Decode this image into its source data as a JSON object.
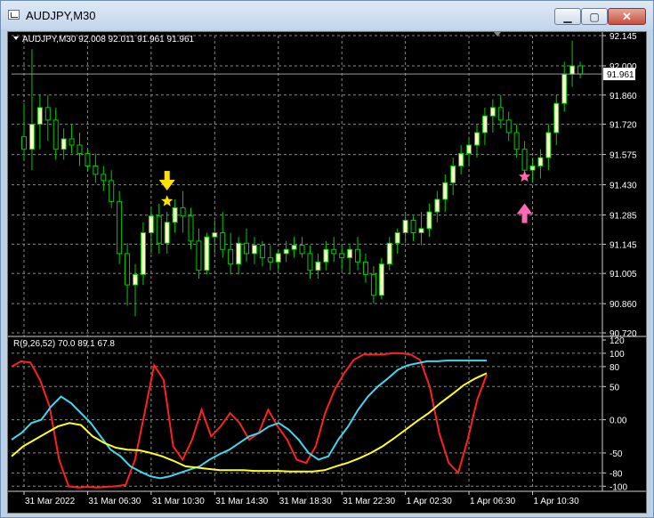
{
  "window": {
    "title": "AUDJPY,M30",
    "min_glyph": "▁",
    "max_glyph": "▢",
    "close_glyph": "✕"
  },
  "price_panel": {
    "header": "AUDJPY,M30  92.008 92.011 91.961 91.961",
    "current_price": "91.961",
    "y_ticks": [
      "92.145",
      "92.000",
      "91.860",
      "91.720",
      "91.575",
      "91.430",
      "91.285",
      "91.145",
      "91.005",
      "90.860",
      "90.720"
    ]
  },
  "indicator_panel": {
    "header": "R(9,26,52) 70.0 89.1 67.8",
    "y_ticks": [
      "120",
      "100",
      "80",
      "50",
      "0.00",
      "-50",
      "-80",
      "-100"
    ]
  },
  "time_axis": [
    "31 Mar 2022",
    "31 Mar 06:30",
    "31 Mar 10:30",
    "31 Mar 14:30",
    "31 Mar 18:30",
    "31 Mar 22:30",
    "1 Apr 02:30",
    "1 Apr 06:30",
    "1 Apr 10:30"
  ],
  "colors": {
    "bg": "#000000",
    "grid": "#8a8a8a",
    "candle_up": "#00cc00",
    "candle_bull_fill": "#ffffcc",
    "line_red": "#ff2020",
    "line_cyan": "#40d8f0",
    "line_yellow": "#ffff20",
    "arrow_down": "#ffe000",
    "arrow_up": "#ff69b4"
  },
  "chart_data": {
    "type": "candlestick",
    "symbol": "AUDJPY",
    "timeframe": "M30",
    "ylim": [
      90.72,
      92.145
    ],
    "candles": [
      [
        91.66,
        91.82,
        91.55,
        91.6
      ],
      [
        91.6,
        92.08,
        91.5,
        91.72
      ],
      [
        91.72,
        91.86,
        91.6,
        91.8
      ],
      [
        91.8,
        91.86,
        91.64,
        91.74
      ],
      [
        91.74,
        91.8,
        91.55,
        91.6
      ],
      [
        91.6,
        91.7,
        91.55,
        91.65
      ],
      [
        91.65,
        91.72,
        91.58,
        91.62
      ],
      [
        91.62,
        91.68,
        91.52,
        91.58
      ],
      [
        91.58,
        91.6,
        91.5,
        91.52
      ],
      [
        91.52,
        91.58,
        91.44,
        91.48
      ],
      [
        91.48,
        91.52,
        91.4,
        91.45
      ],
      [
        91.45,
        91.5,
        91.32,
        91.35
      ],
      [
        91.35,
        91.4,
        91.05,
        91.1
      ],
      [
        91.1,
        91.15,
        90.85,
        90.95
      ],
      [
        90.95,
        91.05,
        90.8,
        91.0
      ],
      [
        91.0,
        91.25,
        90.95,
        91.2
      ],
      [
        91.2,
        91.32,
        91.1,
        91.28
      ],
      [
        91.28,
        91.34,
        91.1,
        91.15
      ],
      [
        91.15,
        91.3,
        91.1,
        91.25
      ],
      [
        91.25,
        91.36,
        91.2,
        91.32
      ],
      [
        91.32,
        91.4,
        91.2,
        91.28
      ],
      [
        91.28,
        91.32,
        91.12,
        91.16
      ],
      [
        91.16,
        91.22,
        90.98,
        91.02
      ],
      [
        91.02,
        91.2,
        91.0,
        91.18
      ],
      [
        91.18,
        91.26,
        91.1,
        91.2
      ],
      [
        91.2,
        91.3,
        91.08,
        91.12
      ],
      [
        91.12,
        91.2,
        91.0,
        91.05
      ],
      [
        91.05,
        91.18,
        91.0,
        91.15
      ],
      [
        91.15,
        91.22,
        91.06,
        91.1
      ],
      [
        91.1,
        91.18,
        91.05,
        91.14
      ],
      [
        91.14,
        91.16,
        91.04,
        91.08
      ],
      [
        91.08,
        91.14,
        91.02,
        91.06
      ],
      [
        91.06,
        91.12,
        91.02,
        91.1
      ],
      [
        91.1,
        91.16,
        91.06,
        91.12
      ],
      [
        91.12,
        91.18,
        91.08,
        91.14
      ],
      [
        91.14,
        91.18,
        91.08,
        91.1
      ],
      [
        91.1,
        91.14,
        90.98,
        91.02
      ],
      [
        91.02,
        91.1,
        90.98,
        91.06
      ],
      [
        91.06,
        91.16,
        91.02,
        91.12
      ],
      [
        91.12,
        91.18,
        91.06,
        91.1
      ],
      [
        91.1,
        91.14,
        91.02,
        91.08
      ],
      [
        91.08,
        91.14,
        91.0,
        91.12
      ],
      [
        91.12,
        91.18,
        91.02,
        91.06
      ],
      [
        91.06,
        91.1,
        90.96,
        91.0
      ],
      [
        91.0,
        91.04,
        90.86,
        90.9
      ],
      [
        90.9,
        91.08,
        90.88,
        91.05
      ],
      [
        91.05,
        91.18,
        91.02,
        91.15
      ],
      [
        91.15,
        91.22,
        91.1,
        91.2
      ],
      [
        91.2,
        91.3,
        91.15,
        91.26
      ],
      [
        91.26,
        91.28,
        91.16,
        91.2
      ],
      [
        91.2,
        91.3,
        91.14,
        91.22
      ],
      [
        91.22,
        91.34,
        91.18,
        91.3
      ],
      [
        91.3,
        91.4,
        91.25,
        91.36
      ],
      [
        91.36,
        91.48,
        91.3,
        91.44
      ],
      [
        91.44,
        91.56,
        91.38,
        91.52
      ],
      [
        91.52,
        91.62,
        91.48,
        91.58
      ],
      [
        91.58,
        91.66,
        91.52,
        91.62
      ],
      [
        91.62,
        91.72,
        91.56,
        91.68
      ],
      [
        91.68,
        91.8,
        91.62,
        91.76
      ],
      [
        91.76,
        91.84,
        91.68,
        91.8
      ],
      [
        91.8,
        91.86,
        91.7,
        91.74
      ],
      [
        91.74,
        91.78,
        91.64,
        91.68
      ],
      [
        91.68,
        91.72,
        91.56,
        91.6
      ],
      [
        91.6,
        91.64,
        91.46,
        91.5
      ],
      [
        91.5,
        91.56,
        91.44,
        91.52
      ],
      [
        91.52,
        91.6,
        91.46,
        91.56
      ],
      [
        91.56,
        91.72,
        91.5,
        91.68
      ],
      [
        91.68,
        91.86,
        91.62,
        91.82
      ],
      [
        91.82,
        92.02,
        91.78,
        91.96
      ],
      [
        91.96,
        92.12,
        91.9,
        92.0
      ],
      [
        92.0,
        92.02,
        91.94,
        91.961
      ]
    ],
    "markers": [
      {
        "type": "arrow-down",
        "candle": 18,
        "color": "#ffe000"
      },
      {
        "type": "star",
        "candle": 18,
        "color": "#ffe000"
      },
      {
        "type": "arrow-up",
        "candle": 63,
        "color": "#ff69b4"
      },
      {
        "type": "star",
        "candle": 63,
        "color": "#ff69b4"
      }
    ],
    "indicator": {
      "name": "R(9,26,52)",
      "ylim": [
        -105,
        120
      ],
      "series": [
        {
          "color": "#ff2020",
          "values": [
            80,
            88,
            86,
            60,
            20,
            -60,
            -100,
            -102,
            -101,
            -102,
            -101,
            -100,
            -98,
            -60,
            10,
            82,
            60,
            -40,
            -60,
            -30,
            15,
            -25,
            -10,
            10,
            -5,
            -30,
            -20,
            15,
            -10,
            -30,
            -60,
            -65,
            -40,
            10,
            45,
            70,
            90,
            98,
            98,
            98,
            100,
            100,
            98,
            90,
            50,
            -20,
            -65,
            -80,
            -30,
            30,
            67.8
          ]
        },
        {
          "color": "#40d8f0",
          "values": [
            -30,
            -20,
            -5,
            0,
            20,
            35,
            25,
            10,
            -5,
            -25,
            -45,
            -55,
            -70,
            -78,
            -85,
            -88,
            -85,
            -80,
            -75,
            -70,
            -60,
            -52,
            -45,
            -35,
            -25,
            -20,
            -10,
            -5,
            -15,
            -30,
            -50,
            -60,
            -55,
            -30,
            -10,
            15,
            35,
            50,
            62,
            75,
            82,
            85,
            88,
            88,
            89,
            89,
            89,
            89.1,
            89.1
          ]
        },
        {
          "color": "#ffff20",
          "values": [
            -55,
            -40,
            -30,
            -20,
            -10,
            -5,
            -8,
            -25,
            -35,
            -42,
            -45,
            -46,
            -50,
            -55,
            -62,
            -70,
            -72,
            -74,
            -76,
            -76,
            -76,
            -77,
            -77,
            -77,
            -78,
            -78,
            -78,
            -76,
            -70,
            -65,
            -58,
            -50,
            -40,
            -28,
            -15,
            -2,
            10,
            25,
            38,
            52,
            62,
            70
          ]
        }
      ]
    }
  }
}
